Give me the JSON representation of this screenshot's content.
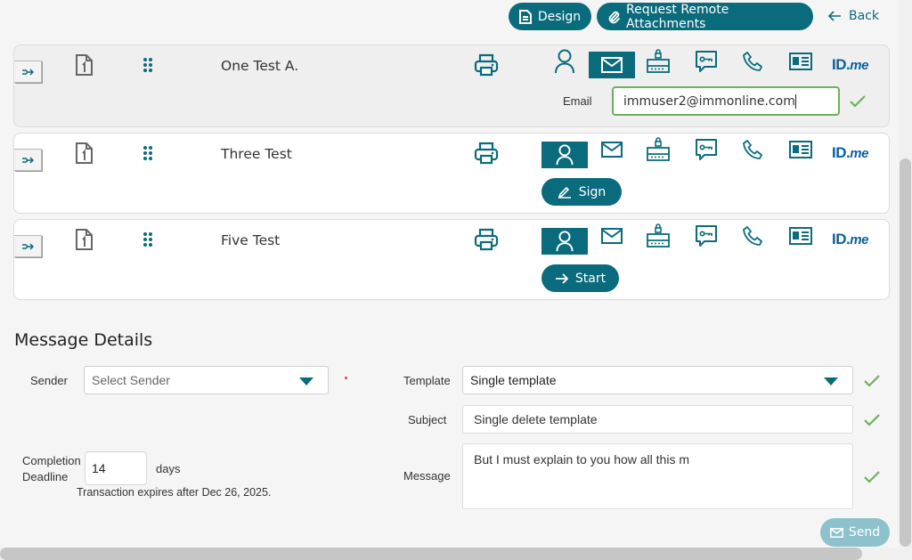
{
  "toolbar": {
    "design_label": "Design",
    "remote_label": "Request Remote Attachments",
    "back_label": "Back"
  },
  "signers": [
    {
      "name": "One Test A.",
      "selected_auth": "email",
      "email_label": "Email",
      "email_value": "immuser2@immonline.com"
    },
    {
      "name": "Three Test",
      "selected_auth": "person",
      "action_label": "Sign",
      "action_icon": "pen-icon"
    },
    {
      "name": "Five Test",
      "selected_auth": "person",
      "action_label": "Start",
      "action_icon": "arrow-right-icon"
    }
  ],
  "auth_methods": [
    "person-icon",
    "envelope-icon",
    "lock-card-icon",
    "chat-key-icon",
    "phone-icon",
    "id-card-icon",
    "idme-logo"
  ],
  "idme": {
    "text": "ID.",
    "suffix": "me"
  },
  "message_details": {
    "title": "Message Details",
    "sender_label": "Sender",
    "sender_placeholder": "Select Sender",
    "template_label": "Template",
    "template_value": "Single template",
    "subject_label": "Subject",
    "subject_value": "Single delete template",
    "completion_label_1": "Completion",
    "completion_label_2": "Deadline",
    "days_value": "14",
    "days_unit": "days",
    "expires_text": "Transaction expires after Dec 26, 2025.",
    "message_label": "Message",
    "message_value": "But I must explain to you how all this m",
    "send_label": "Send"
  },
  "colors": {
    "accent": "#0a6b7c",
    "valid": "#6bb25c",
    "send_disabled": "#8dc2cc",
    "idme": "#0b5f9e"
  }
}
